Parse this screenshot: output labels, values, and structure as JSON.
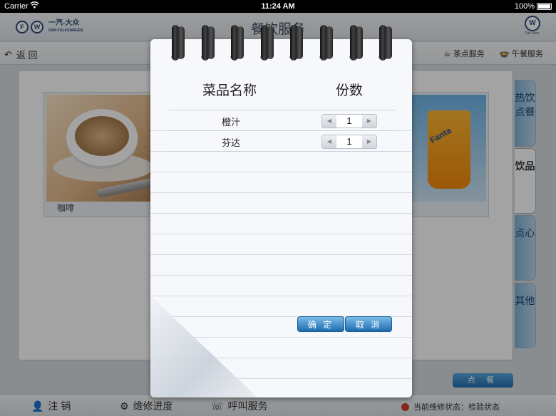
{
  "status_bar": {
    "carrier": "Carrier",
    "time": "11:24 AM",
    "battery": "100%"
  },
  "header": {
    "brand_name": "一汽-大众",
    "brand_sub": "FAW-VOLKSWAGEN",
    "title": "餐饮服务",
    "right_logo_tag": "Das Auto."
  },
  "subnav": {
    "back_label": "返 回",
    "tabs": [
      {
        "label": "茶点服务"
      },
      {
        "label": "午餐服务"
      }
    ]
  },
  "menu_items": [
    {
      "label": "咖啡"
    }
  ],
  "categories": [
    {
      "label": "热饮点餐"
    },
    {
      "label": "饮品"
    },
    {
      "label": "点心"
    },
    {
      "label": "其他"
    }
  ],
  "order_button": "点 餐",
  "bottom_bar": {
    "items": [
      {
        "label": "注 销"
      },
      {
        "label": "维修进度"
      },
      {
        "label": "呼叫服务"
      }
    ],
    "status": "当前维修状态：检验状态"
  },
  "notepad": {
    "col_name": "菜品名称",
    "col_qty": "份数",
    "rows": [
      {
        "name": "橙汁",
        "qty": "1"
      },
      {
        "name": "芬达",
        "qty": "1"
      }
    ],
    "confirm": "确 定",
    "cancel": "取 消"
  },
  "colors": {
    "accent": "#1d6cb0",
    "dim": "rgba(0,0,0,0.36)",
    "tab_blue": "#7fb1d6"
  }
}
